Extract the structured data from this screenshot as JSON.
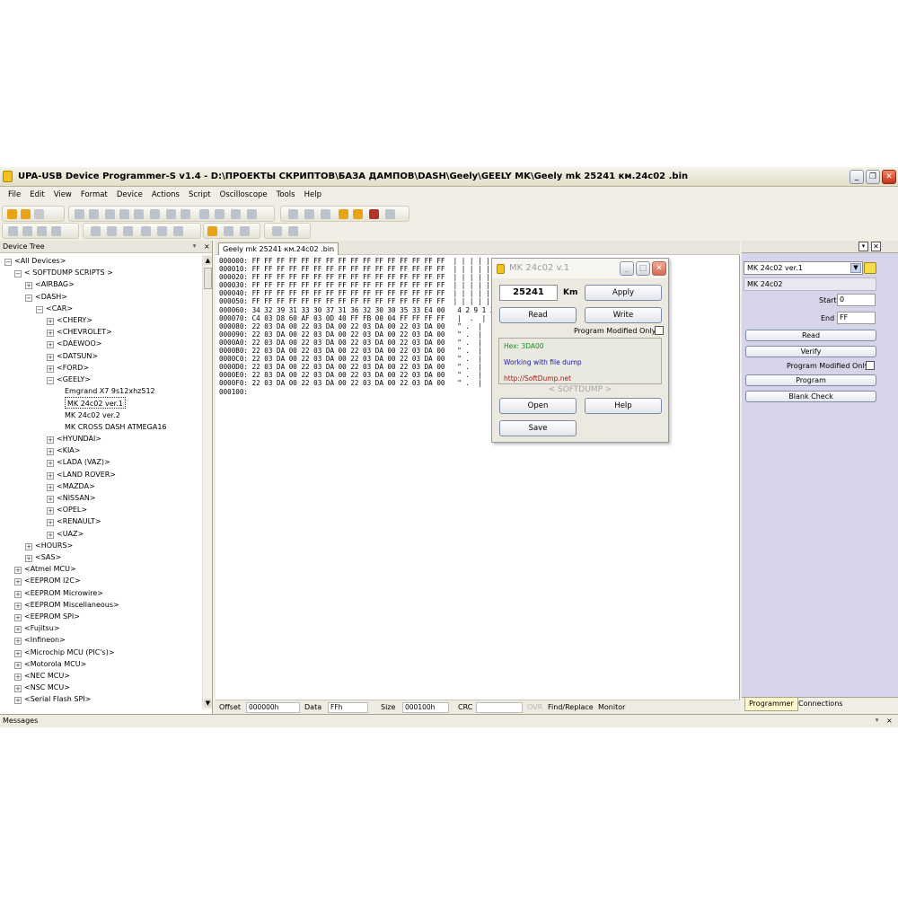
{
  "window": {
    "title": "UPA-USB Device Programmer-S v1.4 - D:\\ПРОЕКТЫ СКРИПТОВ\\БАЗА ДАМПОВ\\DASH\\Geely\\GEELY MK\\Geely mk  25241 км.24c02 .bin"
  },
  "menu": [
    "File",
    "Edit",
    "View",
    "Format",
    "Device",
    "Actions",
    "Script",
    "Oscilloscope",
    "Tools",
    "Help"
  ],
  "device_tree": {
    "header": "Device Tree",
    "pin": "ᵠ",
    "close": "×",
    "items": [
      {
        "label": "<All Devices>",
        "level": 0,
        "exp": "−"
      },
      {
        "label": "< SOFTDUMP SCRIPTS >",
        "level": 1,
        "exp": "−"
      },
      {
        "label": "<AIRBAG>",
        "level": 2,
        "exp": "+"
      },
      {
        "label": "<DASH>",
        "level": 2,
        "exp": "−"
      },
      {
        "label": "<CAR>",
        "level": 3,
        "exp": "−"
      },
      {
        "label": "<CHERY>",
        "level": 4,
        "exp": "+"
      },
      {
        "label": "<CHEVROLET>",
        "level": 4,
        "exp": "+"
      },
      {
        "label": "<DAEWOO>",
        "level": 4,
        "exp": "+"
      },
      {
        "label": "<DATSUN>",
        "level": 4,
        "exp": "+"
      },
      {
        "label": "<FORD>",
        "level": 4,
        "exp": "+"
      },
      {
        "label": "<GEELY>",
        "level": 4,
        "exp": "−"
      },
      {
        "label": "Emgrand X7 9s12xhz512",
        "level": 5,
        "exp": ""
      },
      {
        "label": "MK 24c02 ver.1",
        "level": 5,
        "exp": "",
        "selected": true
      },
      {
        "label": "MK 24c02 ver.2",
        "level": 5,
        "exp": ""
      },
      {
        "label": "MK CROSS DASH ATMEGA16",
        "level": 5,
        "exp": ""
      },
      {
        "label": "<HYUNDAI>",
        "level": 4,
        "exp": "+"
      },
      {
        "label": "<KIA>",
        "level": 4,
        "exp": "+"
      },
      {
        "label": "<LADA (VAZ)>",
        "level": 4,
        "exp": "+"
      },
      {
        "label": "<LAND ROVER>",
        "level": 4,
        "exp": "+"
      },
      {
        "label": "<MAZDA>",
        "level": 4,
        "exp": "+"
      },
      {
        "label": "<NISSAN>",
        "level": 4,
        "exp": "+"
      },
      {
        "label": "<OPEL>",
        "level": 4,
        "exp": "+"
      },
      {
        "label": "<RENAULT>",
        "level": 4,
        "exp": "+"
      },
      {
        "label": "<UAZ>",
        "level": 4,
        "exp": "+"
      },
      {
        "label": "<HOURS>",
        "level": 2,
        "exp": "+"
      },
      {
        "label": "<SAS>",
        "level": 2,
        "exp": "+"
      },
      {
        "label": "<Atmel MCU>",
        "level": 1,
        "exp": "+"
      },
      {
        "label": "<EEPROM I2C>",
        "level": 1,
        "exp": "+"
      },
      {
        "label": "<EEPROM Microwire>",
        "level": 1,
        "exp": "+"
      },
      {
        "label": "<EEPROM Miscellaneous>",
        "level": 1,
        "exp": "+"
      },
      {
        "label": "<EEPROM SPI>",
        "level": 1,
        "exp": "+"
      },
      {
        "label": "<Fujitsu>",
        "level": 1,
        "exp": "+"
      },
      {
        "label": "<Infineon>",
        "level": 1,
        "exp": "+"
      },
      {
        "label": "<Microchip MCU (PIC's)>",
        "level": 1,
        "exp": "+"
      },
      {
        "label": "<Motorola MCU>",
        "level": 1,
        "exp": "+"
      },
      {
        "label": "<NEC MCU>",
        "level": 1,
        "exp": "+"
      },
      {
        "label": "<NSC MCU>",
        "level": 1,
        "exp": "+"
      },
      {
        "label": "<Serial Flash SPI>",
        "level": 1,
        "exp": "+"
      }
    ]
  },
  "hex": {
    "tab": "Geely mk  25241 км.24c02 .bin",
    "rows": [
      {
        "off": "000000:",
        "bytes": "FF FF FF FF FF FF FF FF FF FF FF FF FF FF FF FF",
        "ascii": "| | | | |"
      },
      {
        "off": "000010:",
        "bytes": "FF FF FF FF FF FF FF FF FF FF FF FF FF FF FF FF",
        "ascii": "| | | | |"
      },
      {
        "off": "000020:",
        "bytes": "FF FF FF FF FF FF FF FF FF FF FF FF FF FF FF FF",
        "ascii": "| | | | |"
      },
      {
        "off": "000030:",
        "bytes": "FF FF FF FF FF FF FF FF FF FF FF FF FF FF FF FF",
        "ascii": "| | | | |"
      },
      {
        "off": "000040:",
        "bytes": "FF FF FF FF FF FF FF FF FF FF FF FF FF FF FF FF",
        "ascii": "| | | | |"
      },
      {
        "off": "000050:",
        "bytes": "FF FF FF FF FF FF FF FF FF FF FF FF FF FF FF FF",
        "ascii": "| | | | |"
      },
      {
        "off": "000060:",
        "bytes": "34 32 39 31 33 30 37 31 36 32 30 30 35 33 E4 00",
        "ascii": " 4 2 9 1 3"
      },
      {
        "off": "000070:",
        "bytes": "C4 03 D8 60 AF 03 0D 40 FF FB 00 04 FF FF FF FF",
        "ascii": " |  .  |  `"
      },
      {
        "off": "000080:",
        "bytes": "22 03 DA 00 22 03 DA 00 22 03 DA 00 22 03 DA 00",
        "ascii": " \" .  |  ."
      },
      {
        "off": "000090:",
        "bytes": "22 03 DA 00 22 03 DA 00 22 03 DA 00 22 03 DA 00",
        "ascii": " \" .  |  ."
      },
      {
        "off": "0000A0:",
        "bytes": "22 03 DA 00 22 03 DA 00 22 03 DA 00 22 03 DA 00",
        "ascii": " \" .  |  ."
      },
      {
        "off": "0000B0:",
        "bytes": "22 03 DA 00 22 03 DA 00 22 03 DA 00 22 03 DA 00",
        "ascii": " \" .  |  ."
      },
      {
        "off": "0000C0:",
        "bytes": "22 03 DA 00 22 03 DA 00 22 03 DA 00 22 03 DA 00",
        "ascii": " \" .  |  ."
      },
      {
        "off": "0000D0:",
        "bytes": "22 03 DA 00 22 03 DA 00 22 03 DA 00 22 03 DA 00",
        "ascii": " \" .  |  ."
      },
      {
        "off": "0000E0:",
        "bytes": "22 03 DA 00 22 03 DA 00 22 03 DA 00 22 03 DA 00",
        "ascii": " \" .  |  ."
      },
      {
        "off": "0000F0:",
        "bytes": "22 03 DA 00 22 03 DA 00 22 03 DA 00 22 03 DA 00",
        "ascii": " \" .  |  ."
      },
      {
        "off": "000100:",
        "bytes": "",
        "ascii": ""
      }
    ],
    "status": {
      "offset_label": "Offset",
      "offset": "000000h",
      "data_label": "Data",
      "data": "FFh",
      "size_label": "Size",
      "size": "000100h",
      "crc_label": "CRC",
      "crc": "",
      "ovr": "OVR",
      "find": "Find/Replace",
      "monitor": "Monitor"
    }
  },
  "dialog": {
    "title": "MK 24c02 v.1",
    "km_value": "25241",
    "km_unit": "Km",
    "apply": "Apply",
    "read": "Read",
    "write": "Write",
    "program_modified": "Program Modified Only",
    "hex_line": "Hex: 3DA00",
    "working_line": "Working with file dump",
    "url_line": "http://SoftDump.net",
    "brand": "< SOFTDUMP >",
    "open": "Open",
    "help": "Help",
    "save": "Save",
    "colors": {
      "hex": "#1c8a1c",
      "working": "#1a1aa8",
      "url": "#a01a1a"
    }
  },
  "right_panel": {
    "device_select": "MK 24c02 ver.1",
    "device_name": "MK 24c02",
    "start_label": "Start",
    "start": "0",
    "end_label": "End",
    "end": "FF",
    "read": "Read",
    "verify": "Verify",
    "program_modified": "Program Modified Only",
    "program": "Program",
    "blank_check": "Blank Check",
    "tabs": [
      "Programmer",
      "Connections"
    ]
  },
  "messages": {
    "label": "Messages",
    "pin": "ᵠ",
    "close": "×"
  }
}
